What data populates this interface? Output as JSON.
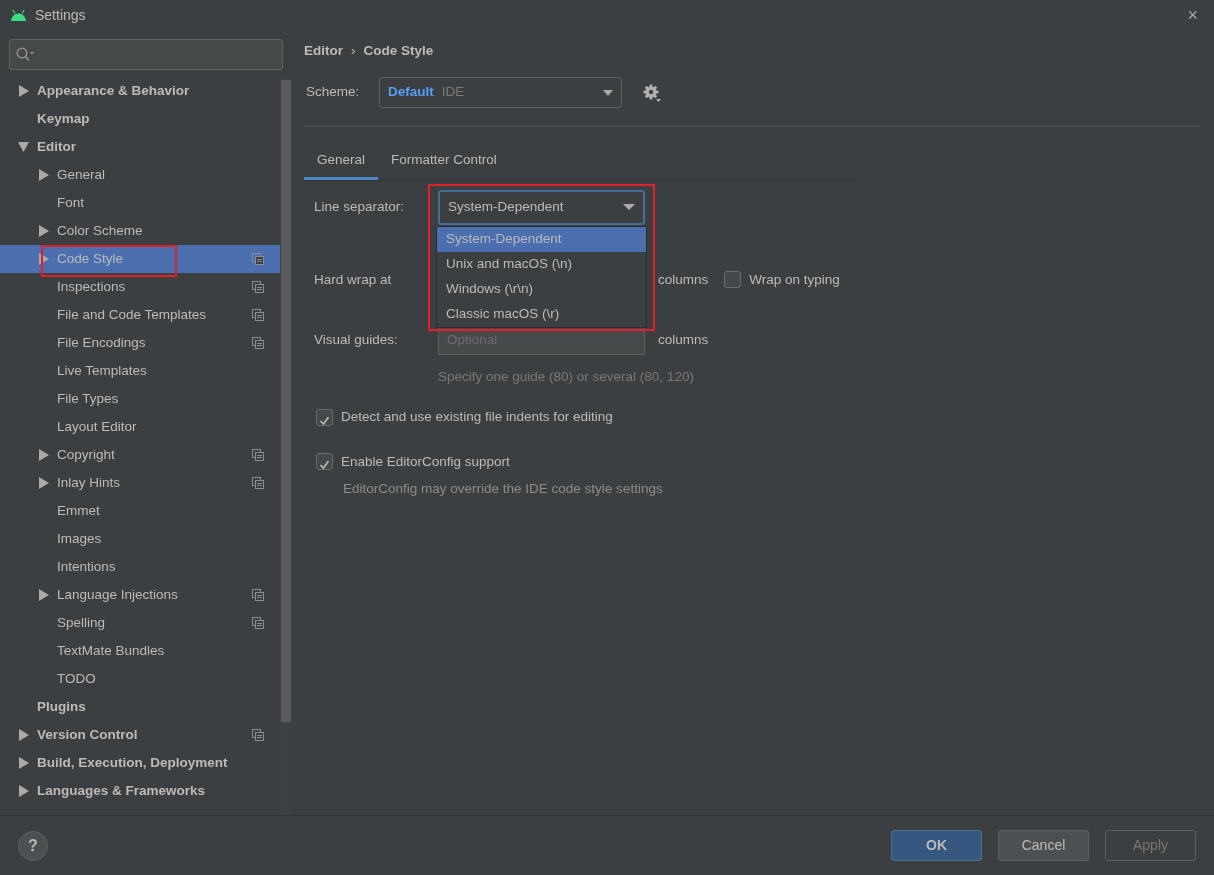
{
  "window": {
    "title": "Settings",
    "close": "×"
  },
  "sidebar": {
    "items": [
      {
        "label": "Appearance & Behavior",
        "kind": "node",
        "expanded": false,
        "selected": false
      },
      {
        "label": "Keymap",
        "kind": "leaf",
        "selected": false
      },
      {
        "label": "Editor",
        "kind": "node",
        "expanded": true,
        "selected": false,
        "children": [
          {
            "label": "General",
            "kind": "node",
            "expanded": false,
            "selected": false
          },
          {
            "label": "Font",
            "kind": "leaf",
            "selected": false
          },
          {
            "label": "Color Scheme",
            "kind": "node",
            "expanded": false,
            "selected": false
          },
          {
            "label": "Code Style",
            "kind": "node",
            "expanded": false,
            "selected": true,
            "project_level": true,
            "outlined": true
          },
          {
            "label": "Inspections",
            "kind": "leaf",
            "selected": false,
            "project_level": true
          },
          {
            "label": "File and Code Templates",
            "kind": "leaf",
            "selected": false,
            "project_level": true
          },
          {
            "label": "File Encodings",
            "kind": "leaf",
            "selected": false,
            "project_level": true
          },
          {
            "label": "Live Templates",
            "kind": "leaf",
            "selected": false
          },
          {
            "label": "File Types",
            "kind": "leaf",
            "selected": false
          },
          {
            "label": "Layout Editor",
            "kind": "leaf",
            "selected": false
          },
          {
            "label": "Copyright",
            "kind": "node",
            "expanded": false,
            "selected": false,
            "project_level": true
          },
          {
            "label": "Inlay Hints",
            "kind": "node",
            "expanded": false,
            "selected": false,
            "project_level": true
          },
          {
            "label": "Emmet",
            "kind": "leaf",
            "selected": false
          },
          {
            "label": "Images",
            "kind": "leaf",
            "selected": false
          },
          {
            "label": "Intentions",
            "kind": "leaf",
            "selected": false
          },
          {
            "label": "Language Injections",
            "kind": "node",
            "expanded": false,
            "selected": false,
            "project_level": true
          },
          {
            "label": "Spelling",
            "kind": "leaf",
            "selected": false,
            "project_level": true
          },
          {
            "label": "TextMate Bundles",
            "kind": "leaf",
            "selected": false
          },
          {
            "label": "TODO",
            "kind": "leaf",
            "selected": false
          }
        ]
      },
      {
        "label": "Plugins",
        "kind": "leaf",
        "selected": false
      },
      {
        "label": "Version Control",
        "kind": "node",
        "expanded": false,
        "selected": false,
        "project_level": true
      },
      {
        "label": "Build, Execution, Deployment",
        "kind": "node",
        "expanded": false,
        "selected": false
      },
      {
        "label": "Languages & Frameworks",
        "kind": "node",
        "expanded": false,
        "selected": false
      }
    ]
  },
  "breadcrumb": {
    "items": [
      "Editor",
      "Code Style"
    ],
    "separator": "›"
  },
  "scheme": {
    "label": "Scheme:",
    "name": "Default",
    "source": "IDE"
  },
  "tabs": [
    {
      "label": "General",
      "selected": true
    },
    {
      "label": "Formatter Control",
      "selected": false
    }
  ],
  "line_separator": {
    "label": "Line separator:",
    "value": "System-Dependent",
    "expanded": true,
    "outlined": true,
    "options": [
      {
        "label": "System-Dependent",
        "selected": true
      },
      {
        "label": "Unix and macOS (\\n)",
        "selected": false
      },
      {
        "label": "Windows (\\r\\n)",
        "selected": false
      },
      {
        "label": "Classic macOS (\\r)",
        "selected": false
      }
    ]
  },
  "hard_wrap": {
    "label": "Hard wrap at",
    "unit": "columns",
    "wrap_on_typing": {
      "label": "Wrap on typing",
      "checked": false
    }
  },
  "visual_guides": {
    "label": "Visual guides:",
    "placeholder": "Optional",
    "unit": "columns",
    "hint": "Specify one guide (80) or several (80, 120)"
  },
  "options": [
    {
      "label": "Detect and use existing file indents for editing",
      "checked": true
    },
    {
      "label": "Enable EditorConfig support",
      "checked": true,
      "note": "EditorConfig may override the IDE code style settings"
    }
  ],
  "help": "?",
  "buttons": [
    {
      "label": "OK",
      "kind": "primary",
      "disabled": false
    },
    {
      "label": "Cancel",
      "kind": "secondary",
      "disabled": false
    },
    {
      "label": "Apply",
      "kind": "secondary",
      "disabled": true
    }
  ]
}
